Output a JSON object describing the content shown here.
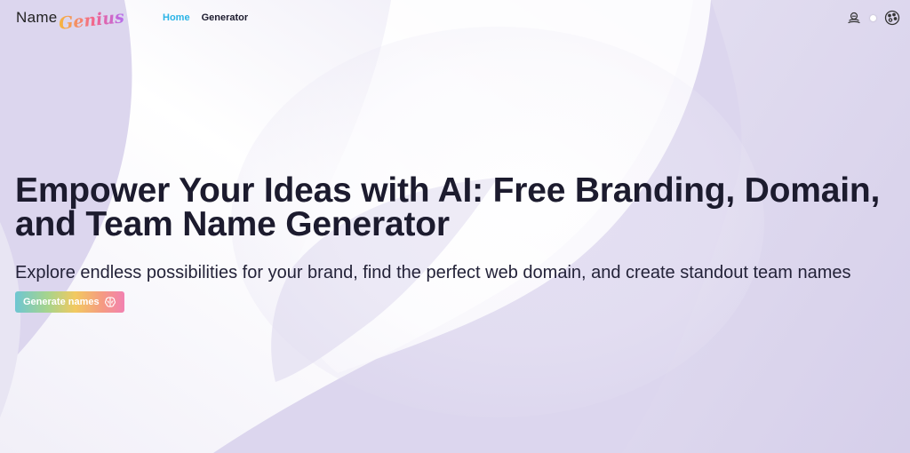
{
  "nav": {
    "logo_name": "Name",
    "logo_genius": "Genius",
    "links": [
      {
        "label": "Home",
        "active": true
      },
      {
        "label": "Generator",
        "active": false
      }
    ],
    "icons": [
      "ai-agent-icon",
      "theme-toggle-icon",
      "palette-icon"
    ]
  },
  "hero": {
    "title_line1": "Empower Your Ideas with AI: Free Branding, Domain,",
    "title_line2": "and Team Name Generator",
    "subtitle": "Explore endless possibilities for your brand, find the perfect web domain, and create standout team names",
    "cta_label": "Generate names",
    "cta_icon": "brain-icon"
  },
  "colors": {
    "background": "#ddd8ee",
    "active_link": "#2bb4e6",
    "text": "#1c1b2e"
  }
}
